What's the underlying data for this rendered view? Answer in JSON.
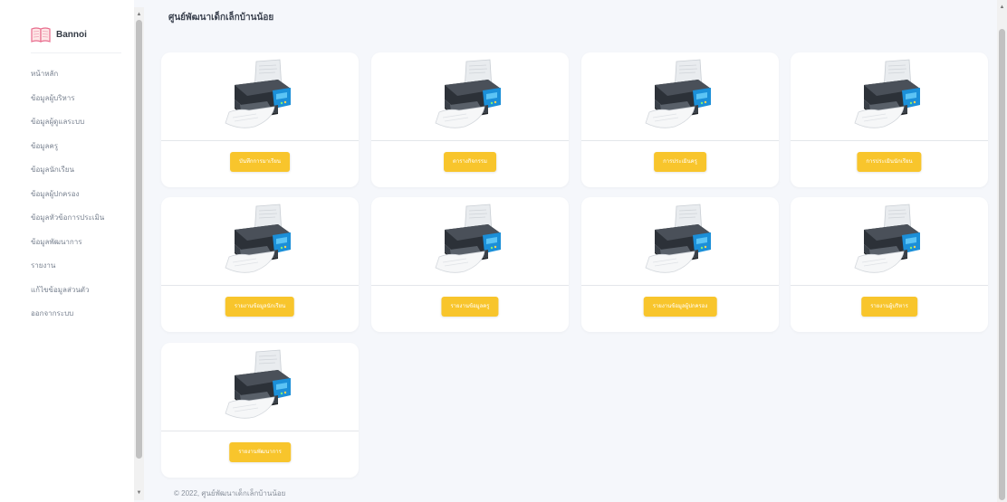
{
  "brand": {
    "name": "Bannoi"
  },
  "nav": {
    "items": [
      "หน้าหลัก",
      "ข้อมูลผู้บริหาร",
      "ข้อมูลผู้ดูแลระบบ",
      "ข้อมูลครู",
      "ข้อมูลนักเรียน",
      "ข้อมูลผู้ปกครอง",
      "ข้อมูลหัวข้อการประเมิน",
      "ข้อมูลพัฒนาการ",
      "รายงาน",
      "แก้ไขข้อมูลส่วนตัว",
      "ออกจากระบบ"
    ]
  },
  "page": {
    "title": "ศูนย์พัฒนาเด็กเล็กบ้านน้อย"
  },
  "cards": [
    {
      "button": "บันทึกการมาเรียน",
      "icon": "printer-icon"
    },
    {
      "button": "ตารางกิจกรรม",
      "icon": "printer-icon"
    },
    {
      "button": "การประเมินครู",
      "icon": "printer-icon"
    },
    {
      "button": "การประเมินนักเรียน",
      "icon": "printer-icon"
    },
    {
      "button": "รายงานข้อมูลนักเรียน",
      "icon": "printer-icon"
    },
    {
      "button": "รายงานข้อมูลครู",
      "icon": "printer-icon"
    },
    {
      "button": "รายงานข้อมูลผู้ปกครอง",
      "icon": "printer-icon"
    },
    {
      "button": "รายงานผู้บริหาร",
      "icon": "printer-icon"
    },
    {
      "button": "รายงานพัฒนาการ",
      "icon": "printer-icon"
    }
  ],
  "footer": {
    "text": "© 2022, ศูนย์พัฒนาเด็กเล็กบ้านน้อย"
  },
  "colors": {
    "accent": "#f8c52c",
    "background": "#f5f7fb",
    "card": "#ffffff"
  }
}
